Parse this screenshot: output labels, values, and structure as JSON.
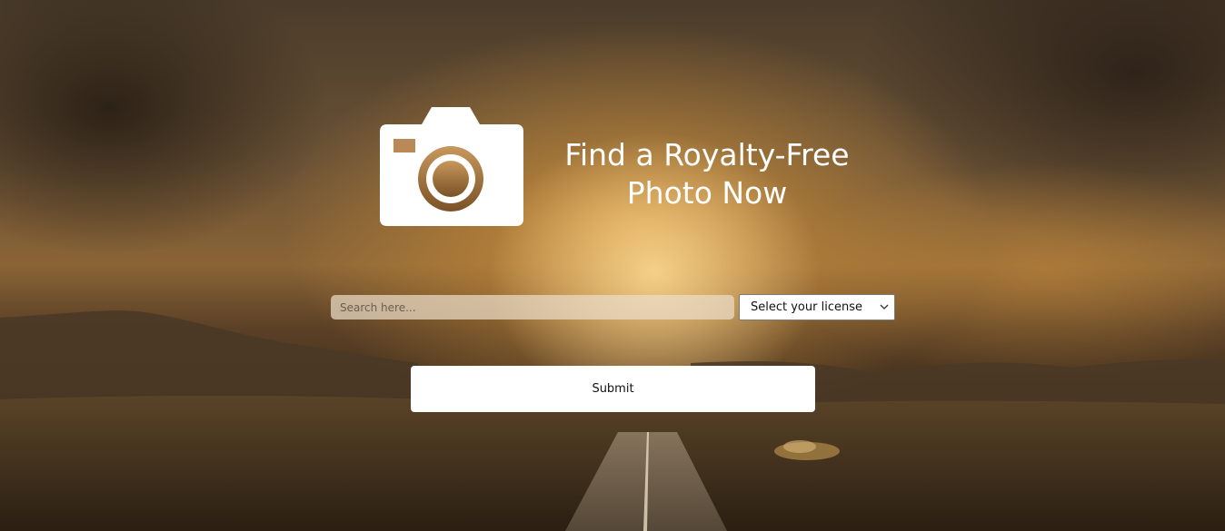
{
  "hero": {
    "title_line1": "Find a Royalty-Free",
    "title_line2": "Photo Now",
    "camera_icon": "camera-icon"
  },
  "search": {
    "placeholder": "Search here...",
    "value": ""
  },
  "license": {
    "selected": "Select your license",
    "icon": "chevron-down-icon"
  },
  "form": {
    "submit_label": "Submit"
  },
  "colors": {
    "text_primary": "#ffffff",
    "button_bg": "#ffffff",
    "camera_lens": "#b98a55"
  }
}
